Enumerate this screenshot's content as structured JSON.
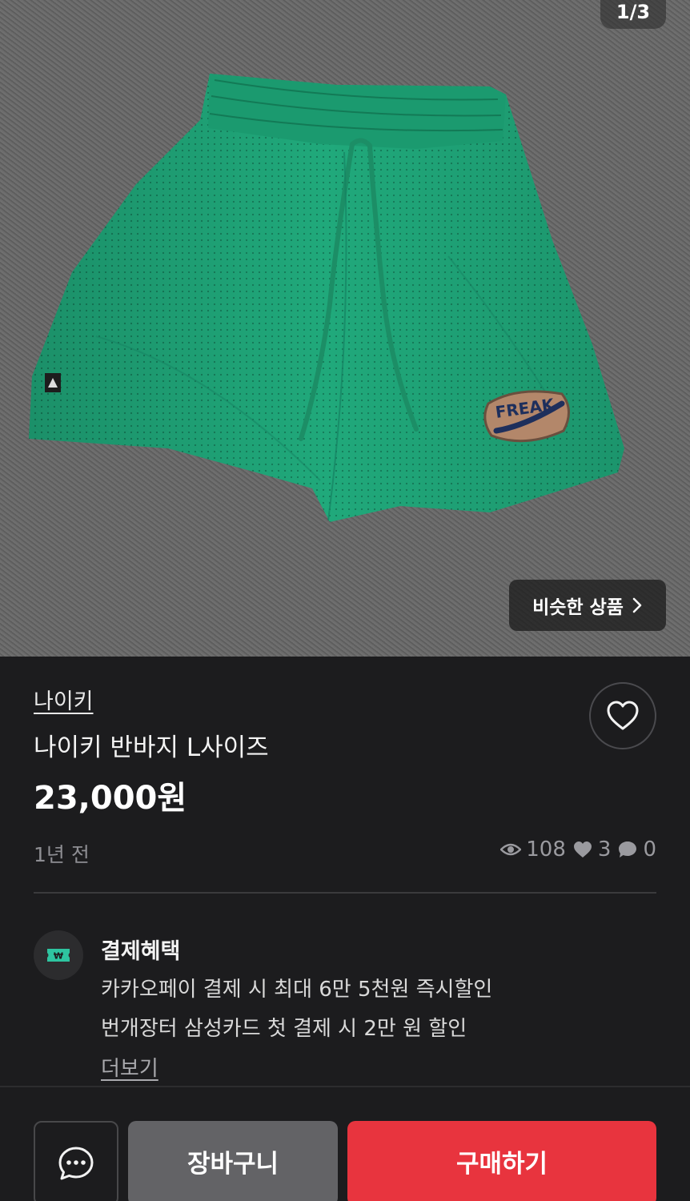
{
  "gallery": {
    "pager": "1/3",
    "similar_label": "비슷한 상품",
    "patch_text": "FREAK"
  },
  "product": {
    "brand": "나이키",
    "title": "나이키 반바지 L사이즈",
    "price": "23,000원",
    "posted": "1년 전",
    "stats": {
      "views": "108",
      "likes": "3",
      "chats": "0"
    }
  },
  "benefit": {
    "title": "결제혜택",
    "lines": [
      "카카오페이 결제 시 최대 6만 5천원 즉시할인",
      "번개장터 삼성카드 첫 결제 시 2만 원  할인"
    ],
    "more": "더보기"
  },
  "actions": {
    "cart": "장바구니",
    "buy": "구매하기"
  },
  "colors": {
    "background": "#1c1c1e",
    "buy_button": "#e8343e",
    "cart_button": "#636366",
    "shorts_green": "#1fa87a",
    "benefit_icon": "#2ec4a0"
  },
  "icons": {
    "similar_arrow": "chevron-right-icon",
    "like": "heart-outline-icon",
    "views": "eye-icon",
    "likes": "heart-filled-icon",
    "chats": "chat-bubble-icon",
    "benefit": "won-ticket-icon",
    "chat_button": "chat-dots-icon"
  }
}
